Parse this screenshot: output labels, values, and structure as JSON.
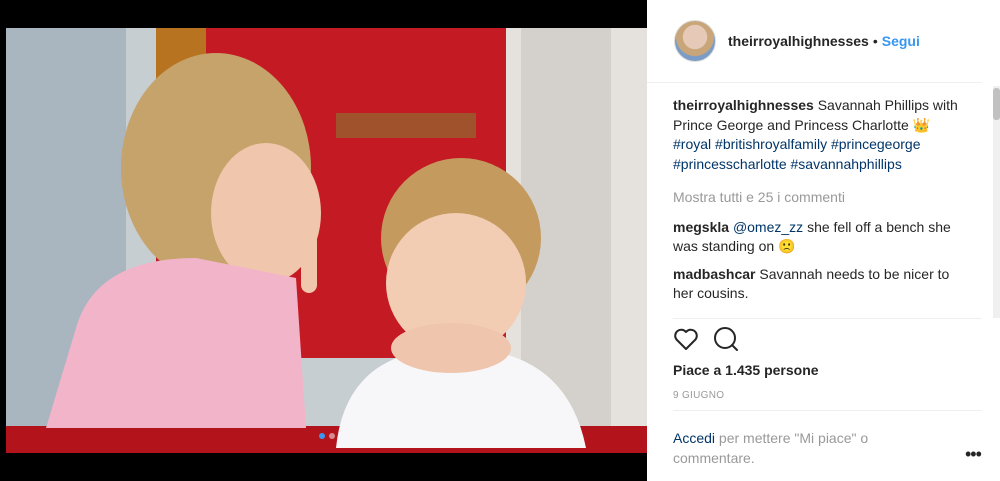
{
  "post": {
    "username": "theirroyalhighnesses",
    "separator": "•",
    "follow_label": "Segui",
    "caption_username": "theirroyalhighnesses",
    "caption_text": "Savannah Phillips with Prince George and Princess Charlotte 👑",
    "hashtags": [
      "#royal",
      "#britishroyalfamily",
      "#princegeorge",
      "#princesscharlotte",
      "#savannahphillips"
    ],
    "view_all_comments": "Mostra tutti e 25 i commenti",
    "comments": [
      {
        "user": "megskla",
        "mention": "@omez_zz",
        "text": "she fell off a bench she was standing on 🙁"
      },
      {
        "user": "madbashcar",
        "mention": "",
        "text": "Savannah needs to be nicer to her cousins."
      }
    ],
    "likes_text": "Piace a 1.435 persone",
    "date": "9 GIUGNO",
    "login_link": "Accedi",
    "login_text": "per mettere \"Mi piace\" o commentare.",
    "menu_icon": "•••",
    "carousel": {
      "count": 2,
      "active": 0
    },
    "colors": {
      "link_blue": "#3897f0",
      "hashtag_blue": "#003569",
      "muted": "#999999"
    }
  }
}
